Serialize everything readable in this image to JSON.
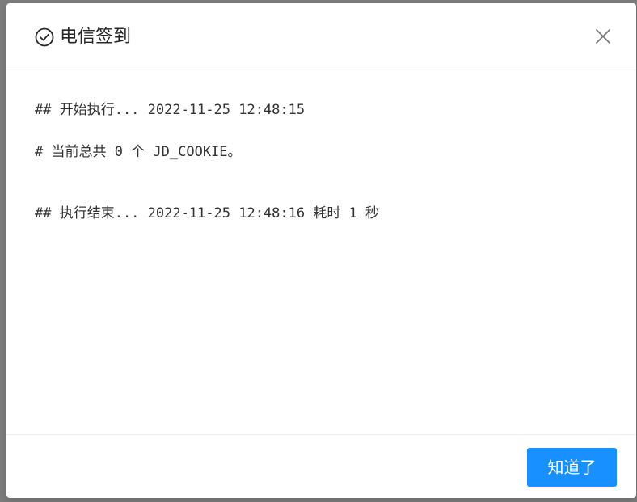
{
  "dialog": {
    "title": "电信签到",
    "title_icon": "check-circle-icon",
    "close_icon": "close-icon",
    "ok_label": "知道了"
  },
  "log": {
    "lines": [
      "## 开始执行... 2022-11-25 12:48:15",
      "# 当前总共 0 个 JD_COOKIE。",
      "## 执行结束... 2022-11-25 12:48:16 耗时 1 秒"
    ]
  },
  "colors": {
    "primary": "#1890ff",
    "title_text": "#262626",
    "log_text": "#333333",
    "overlay": "#7d7d7d"
  }
}
